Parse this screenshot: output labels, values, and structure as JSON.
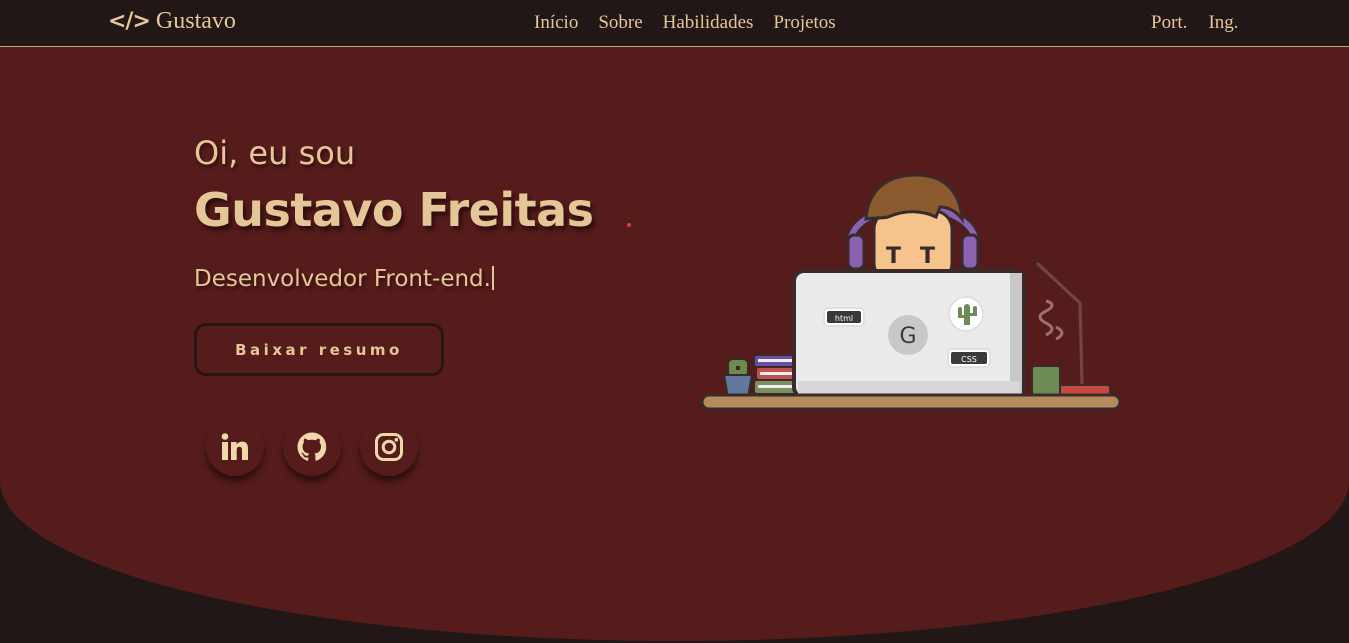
{
  "header": {
    "logo_icon": "</>",
    "logo_text": "Gustavo",
    "nav": [
      "Início",
      "Sobre",
      "Habilidades",
      "Projetos"
    ],
    "languages": [
      "Port.",
      "Ing."
    ]
  },
  "hero": {
    "greeting": "Oi, eu sou",
    "name": "Gustavo Freitas",
    "role": "Desenvolvedor Front-end.",
    "cta_label": "Baixar resumo",
    "socials": [
      {
        "name": "linkedin",
        "icon": "linkedin-icon"
      },
      {
        "name": "github",
        "icon": "github-icon"
      },
      {
        "name": "instagram",
        "icon": "instagram-icon"
      }
    ],
    "laptop_tags": {
      "html": "html",
      "css": "CSS",
      "logo": "G"
    }
  },
  "colors": {
    "header_bg": "#201716",
    "hero_bg": "#561b1b",
    "accent_text": "#e5c697"
  }
}
